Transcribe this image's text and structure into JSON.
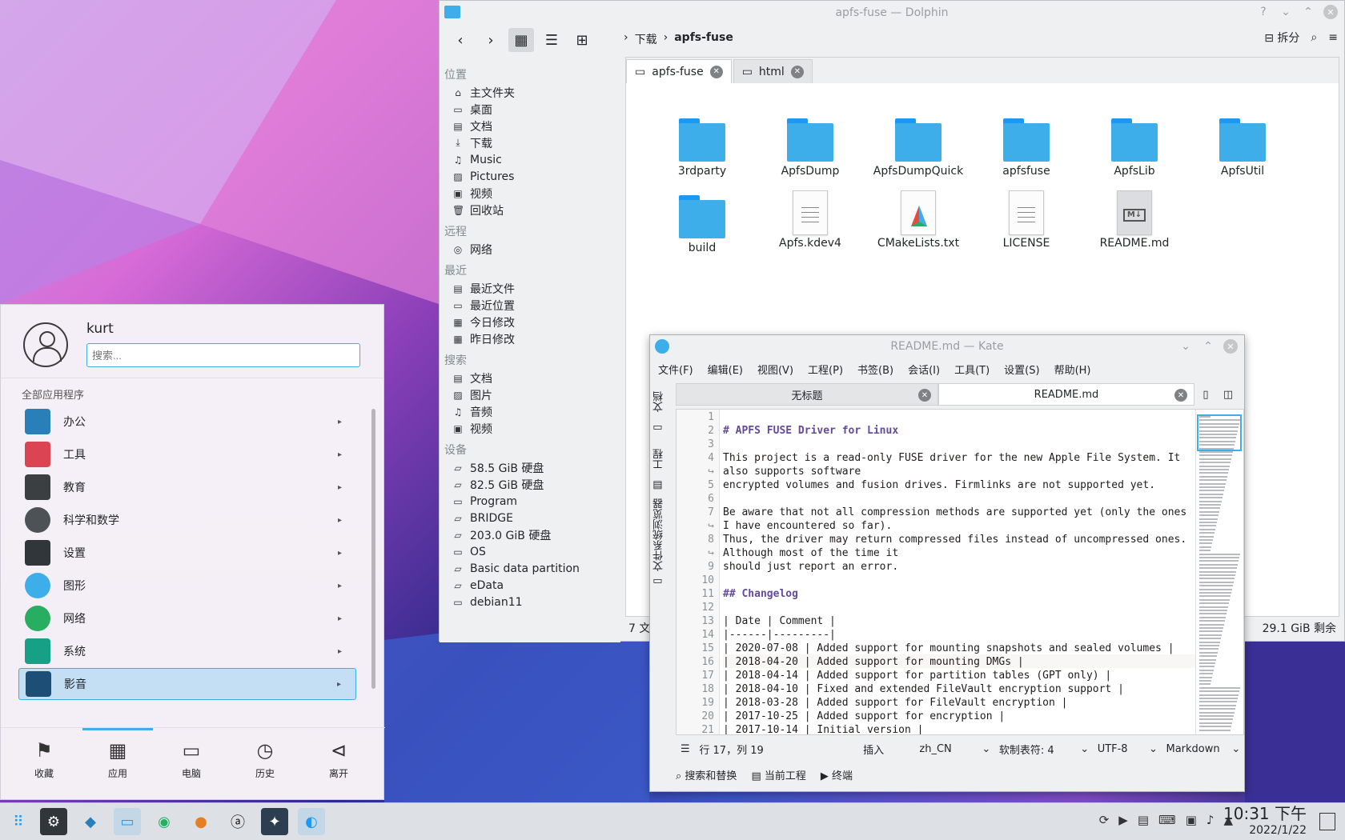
{
  "dolphin": {
    "title": "apfs-fuse — Dolphin",
    "breadcrumb": [
      "下载",
      "apfs-fuse"
    ],
    "split_label": "拆分",
    "places": [
      {
        "section": "位置",
        "items": [
          "主文件夹",
          "桌面",
          "文档",
          "下载",
          "Music",
          "Pictures",
          "视频",
          "回收站"
        ]
      },
      {
        "section": "远程",
        "items": [
          "网络"
        ]
      },
      {
        "section": "最近",
        "items": [
          "最近文件",
          "最近位置",
          "今日修改",
          "昨日修改"
        ]
      },
      {
        "section": "搜索",
        "items": [
          "文档",
          "图片",
          "音频",
          "视频"
        ]
      },
      {
        "section": "设备",
        "items": [
          "58.5 GiB 硬盘",
          "82.5 GiB 硬盘",
          "Program",
          "BRIDGE",
          "203.0 GiB 硬盘",
          "OS",
          "Basic data partition",
          "eData",
          "debian11"
        ]
      }
    ],
    "tabs": [
      "apfs-fuse",
      "html"
    ],
    "files": [
      {
        "name": "3rdparty",
        "kind": "folder"
      },
      {
        "name": "ApfsDump",
        "kind": "folder"
      },
      {
        "name": "ApfsDumpQuick",
        "kind": "folder"
      },
      {
        "name": "apfsfuse",
        "kind": "folder"
      },
      {
        "name": "ApfsLib",
        "kind": "folder"
      },
      {
        "name": "ApfsUtil",
        "kind": "folder"
      },
      {
        "name": "build",
        "kind": "folder"
      },
      {
        "name": "Apfs.kdev4",
        "kind": "text"
      },
      {
        "name": "CMakeLists.txt",
        "kind": "cmake"
      },
      {
        "name": "LICENSE",
        "kind": "text"
      },
      {
        "name": "README.md",
        "kind": "markdown"
      }
    ],
    "status_left": "7 文件",
    "status_right": "29.1 GiB 剩余"
  },
  "kate": {
    "title": "README.md — Kate",
    "menu": [
      "文件(F)",
      "编辑(E)",
      "视图(V)",
      "工程(P)",
      "书签(B)",
      "会话(I)",
      "工具(T)",
      "设置(S)",
      "帮助(H)"
    ],
    "side_tabs": [
      "文档",
      "工程",
      "文件系统浏览器"
    ],
    "tabs": [
      "无标题",
      "README.md"
    ],
    "line_numbers": [
      "1",
      "2",
      "3",
      "4",
      "↪",
      "5",
      "6",
      "7",
      "↪",
      "8",
      "↪",
      "9",
      "10",
      "11",
      "12",
      "13",
      "14",
      "15",
      "16",
      "17",
      "18",
      "19",
      "20",
      "21"
    ],
    "code_lines": [
      "",
      "# APFS FUSE Driver for Linux",
      "",
      "This project is a read-only FUSE driver for the new Apple File System. It",
      "also supports software",
      "encrypted volumes and fusion drives. Firmlinks are not supported yet.",
      "",
      "Be aware that not all compression methods are supported yet (only the ones",
      "I have encountered so far).",
      "Thus, the driver may return compressed files instead of uncompressed ones.",
      "Although most of the time it",
      "should just report an error.",
      "",
      "## Changelog",
      "",
      "| Date | Comment |",
      "|------|---------|",
      "| 2020-07-08 | Added support for mounting snapshots and sealed volumes |",
      "| 2018-04-20 | Added support for mounting DMGs |",
      "| 2018-04-14 | Added support for partition tables (GPT only) |",
      "| 2018-04-10 | Fixed and extended FileVault encryption support |",
      "| 2018-03-28 | Added support for FileVault encryption |",
      "| 2017-10-25 | Added support for encryption |",
      "| 2017-10-14 | Initial version |"
    ],
    "status": {
      "position": "行 17，列 19",
      "mode": "插入",
      "lang": "zh_CN",
      "indent": "软制表符: 4",
      "encoding": "UTF-8",
      "syntax": "Markdown"
    },
    "bottom_tools": [
      "搜索和替换",
      "当前工程",
      "终端"
    ]
  },
  "launcher": {
    "user": "kurt",
    "search_placeholder": "搜索...",
    "all_apps": "全部应用程序",
    "categories": [
      "办公",
      "工具",
      "教育",
      "科学和数学",
      "设置",
      "图形",
      "网络",
      "系统",
      "影音"
    ],
    "footer": [
      "收藏",
      "应用",
      "电脑",
      "历史",
      "离开"
    ]
  },
  "taskbar": {
    "time": "10:31 下午",
    "date": "2022/1/22"
  }
}
